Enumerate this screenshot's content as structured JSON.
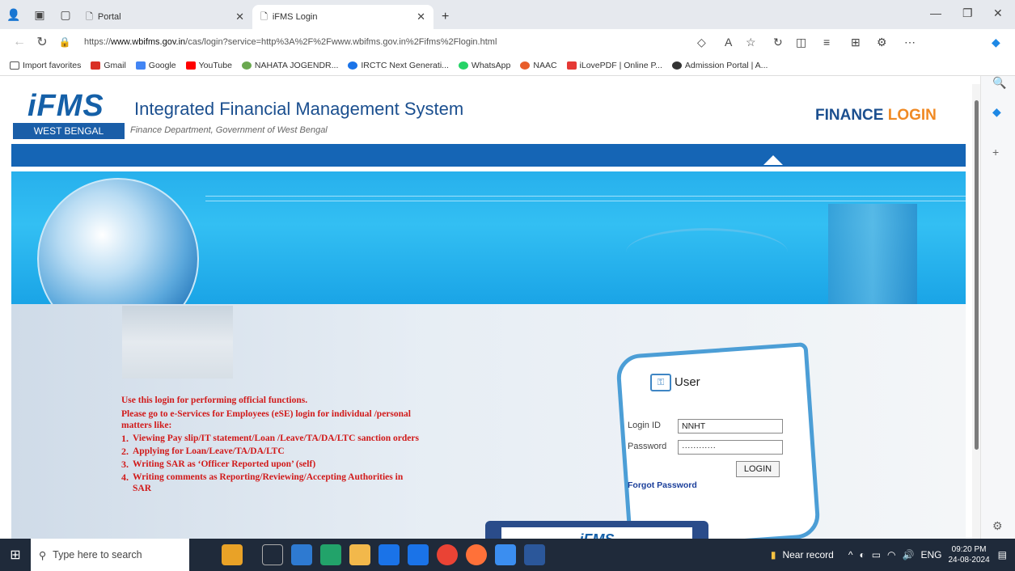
{
  "browser": {
    "tabs": [
      {
        "label": "Portal",
        "active": false
      },
      {
        "label": "iFMS Login",
        "active": true
      }
    ],
    "url_prefix": "https://",
    "url_host": "www.wbifms.gov.in",
    "url_rest": "/cas/login?service=http%3A%2F%2Fwww.wbifms.gov.in%2Fifms%2Flogin.html",
    "favorites": [
      {
        "label": "Import favorites",
        "color": "#555555"
      },
      {
        "label": "Gmail",
        "color": "#d93025"
      },
      {
        "label": "Google",
        "color": "#4285f4"
      },
      {
        "label": "YouTube",
        "color": "#ff0000"
      },
      {
        "label": "NAHATA JOGENDR...",
        "color": "#6aa84f"
      },
      {
        "label": "IRCTC Next Generati...",
        "color": "#1a73e8"
      },
      {
        "label": "WhatsApp",
        "color": "#25d366"
      },
      {
        "label": "NAAC",
        "color": "#e85d2a"
      },
      {
        "label": "iLovePDF | Online P...",
        "color": "#e53935"
      },
      {
        "label": "Admission Portal | A...",
        "color": "#333333"
      }
    ]
  },
  "header": {
    "logo_text": "iFMS",
    "logo_sub": "WEST BENGAL",
    "title": "Integrated Financial Management System",
    "subtitle": "Finance Department, Government of West Bengal",
    "finance_login_1": "FINANCE",
    "finance_login_2": "LOGIN"
  },
  "notice": {
    "line1": "Use this login for performing official functions.",
    "line2": "Please go to e-Services for Employees (eSE) login for individual /personal matters like:",
    "items": [
      {
        "num": "1.",
        "text": "Viewing Pay slip/IT statement/Loan /Leave/TA/DA/LTC sanction orders"
      },
      {
        "num": "2.",
        "text": "Applying for Loan/Leave/TA/DA/LTC"
      },
      {
        "num": "3.",
        "text": "Writing SAR as ‘Officer Reported upon’ (self)"
      },
      {
        "num": "4.",
        "text": "Writing comments as Reporting/Reviewing/Accepting Authorities in SAR"
      }
    ]
  },
  "login": {
    "heading": "User",
    "login_id_label": "Login ID",
    "login_id_value": "NNHT",
    "password_label": "Password",
    "password_value": "············",
    "button": "LOGIN",
    "forgot": "Forgot Password"
  },
  "bottom_card_text": "iFMS",
  "taskbar": {
    "search_placeholder": "Type here to search",
    "weather": "Near record",
    "lang": "ENG",
    "time": "09:20 PM",
    "date": "24-08-2024"
  }
}
